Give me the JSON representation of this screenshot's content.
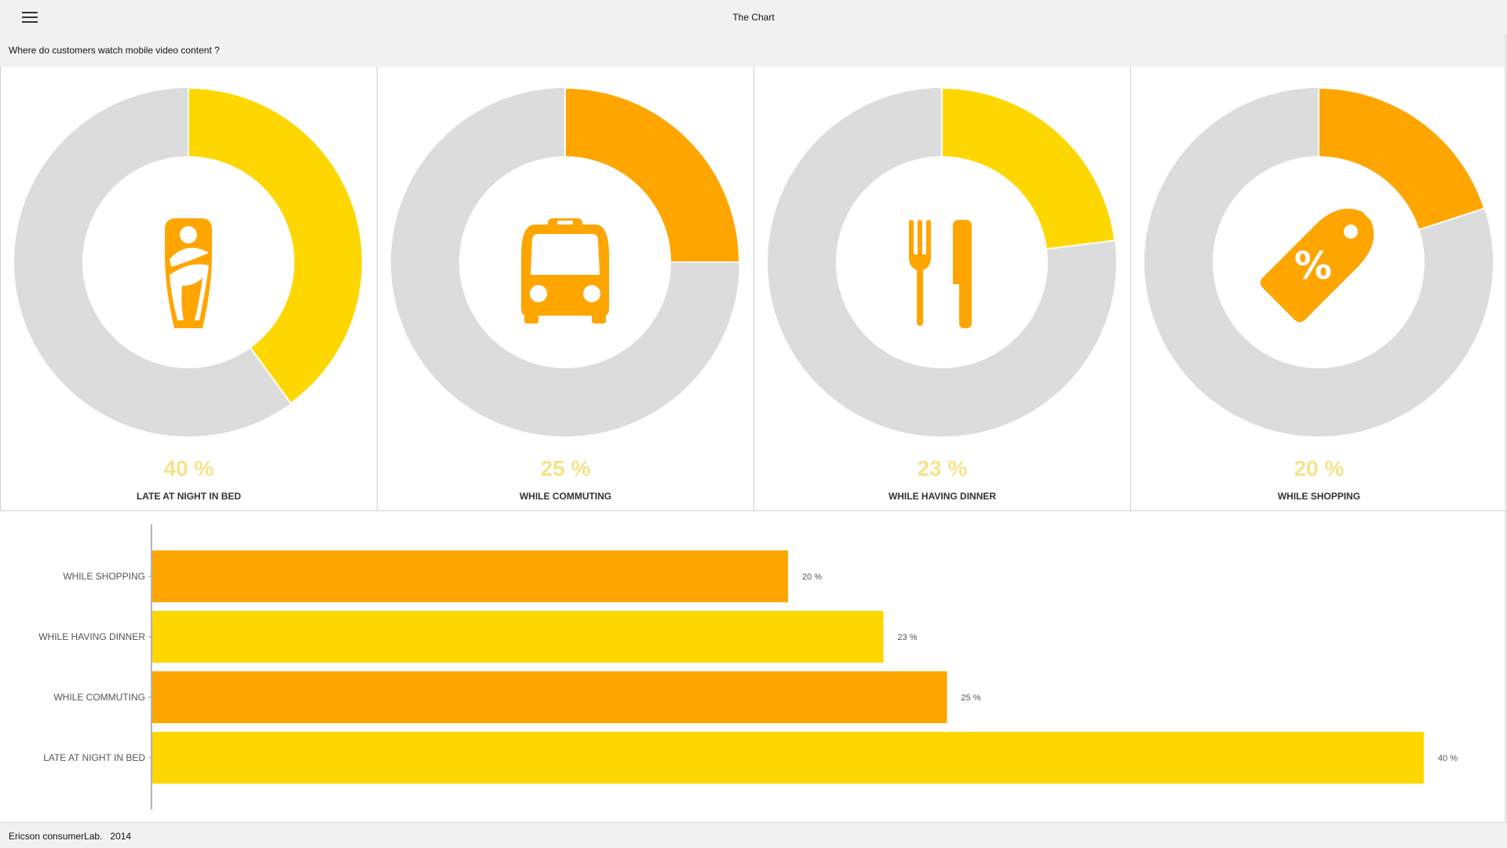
{
  "app": {
    "title": "The Chart"
  },
  "header": {
    "question": "Where do customers watch mobile video content ?"
  },
  "colors": {
    "yellow": "#FFD700",
    "orange": "#FFA500",
    "track": "#DCDCDC",
    "pct_text": "#F6E38A"
  },
  "donuts": [
    {
      "label": "LATE AT NIGHT IN BED",
      "percent": 40,
      "percent_text": "40 %",
      "color": "#FFD700",
      "icon": "baby-bottle-icon"
    },
    {
      "label": "WHILE COMMUTING",
      "percent": 25,
      "percent_text": "25 %",
      "color": "#FFA500",
      "icon": "bus-icon"
    },
    {
      "label": "WHILE HAVING DINNER",
      "percent": 23,
      "percent_text": "23 %",
      "color": "#FFD700",
      "icon": "fork-knife-icon"
    },
    {
      "label": "WHILE SHOPPING",
      "percent": 20,
      "percent_text": "20 %",
      "color": "#FFA500",
      "icon": "price-tag-icon"
    }
  ],
  "chart_data": {
    "type": "bar",
    "orientation": "horizontal",
    "categories": [
      "WHILE SHOPPING",
      "WHILE HAVING DINNER",
      "WHILE COMMUTING",
      "LATE AT NIGHT IN BED"
    ],
    "values": [
      20,
      23,
      25,
      40
    ],
    "value_labels": [
      "20 %",
      "23 %",
      "25 %",
      "40 %"
    ],
    "colors": [
      "#FFA500",
      "#FFD700",
      "#FFA500",
      "#FFD700"
    ],
    "xlim": [
      0,
      40
    ],
    "grid": false,
    "legend": "none"
  },
  "footer": {
    "source": "Ericson consumerLab.",
    "year": "2014"
  }
}
